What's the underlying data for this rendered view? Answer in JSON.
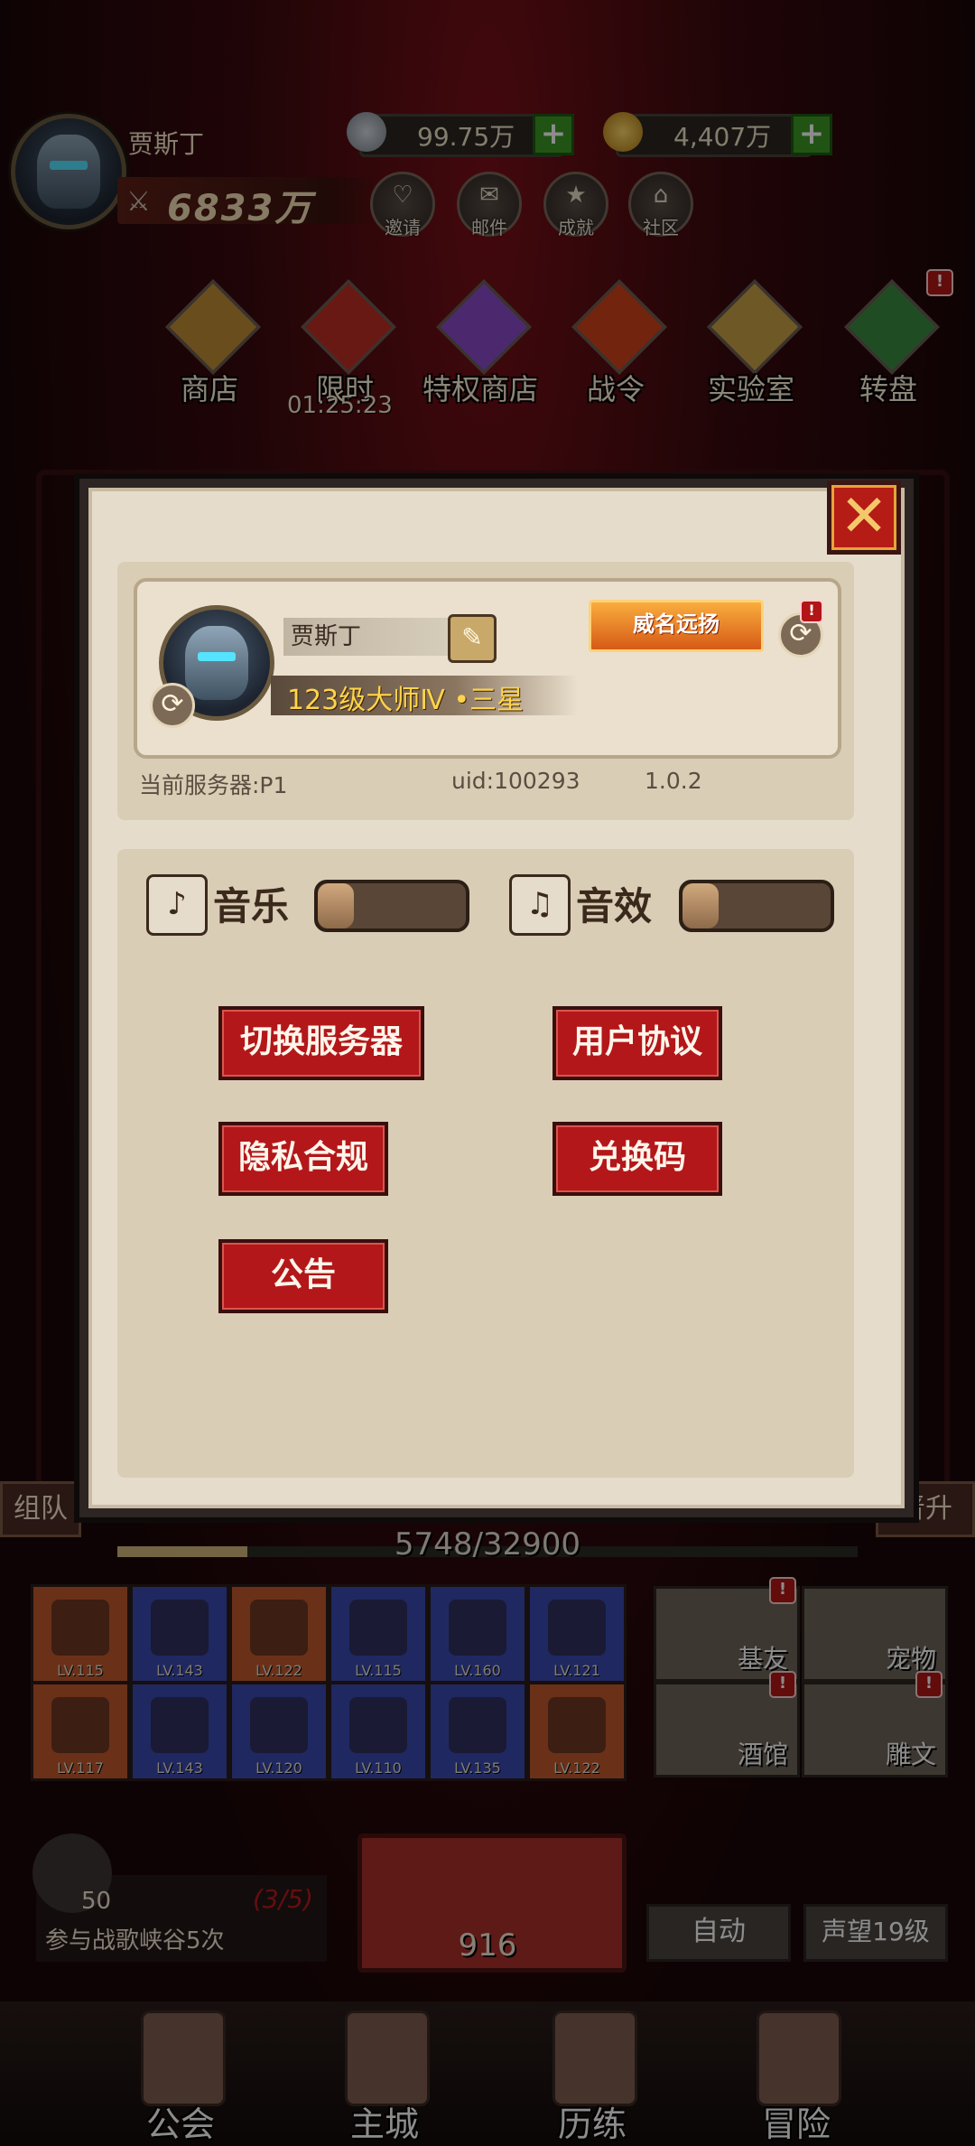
{
  "player": {
    "name": "贾斯丁",
    "power": "6833万"
  },
  "currency": {
    "silver": "99.75万",
    "gold": "4,407万"
  },
  "top_buttons": [
    {
      "label": "邀请",
      "icon": "heart-icon",
      "glyph": "♡"
    },
    {
      "label": "邮件",
      "icon": "mail-icon",
      "glyph": "✉"
    },
    {
      "label": "成就",
      "icon": "star-icon",
      "glyph": "★"
    },
    {
      "label": "社区",
      "icon": "house-icon",
      "glyph": "⌂"
    }
  ],
  "shops": [
    {
      "label": "商店",
      "color": "#c08c34"
    },
    {
      "label": "限时",
      "color": "#c02f26"
    },
    {
      "label": "特权商店",
      "color": "#8b4cc8"
    },
    {
      "label": "战令",
      "color": "#d0431b"
    },
    {
      "label": "实验室",
      "color": "#c8a044"
    },
    {
      "label": "转盘",
      "color": "#3b8a43"
    }
  ],
  "limited_timer": "01:25:23",
  "side_tabs": {
    "left": "组队",
    "right": "晋升"
  },
  "exp": {
    "text": "5748/32900",
    "fraction": 0.175
  },
  "equipment": [
    {
      "lv": "LV.115",
      "color": "#c25a2c"
    },
    {
      "lv": "LV.143",
      "color": "#3a4ab0"
    },
    {
      "lv": "LV.122",
      "color": "#c25a2c"
    },
    {
      "lv": "LV.115",
      "color": "#3a4ab0"
    },
    {
      "lv": "LV.160",
      "color": "#3a4ab0"
    },
    {
      "lv": "LV.121",
      "color": "#3a4ab0"
    },
    {
      "lv": "LV.117",
      "color": "#c25a2c"
    },
    {
      "lv": "LV.143",
      "color": "#3a4ab0"
    },
    {
      "lv": "LV.120",
      "color": "#3a4ab0"
    },
    {
      "lv": "LV.110",
      "color": "#3a4ab0"
    },
    {
      "lv": "LV.135",
      "color": "#3a4ab0"
    },
    {
      "lv": "LV.122",
      "color": "#c25a2c"
    }
  ],
  "social": [
    "基友",
    "宠物",
    "酒馆",
    "雕文"
  ],
  "quest": {
    "count": "50",
    "progress": "(3/5)",
    "text": "参与战歌峡谷5次"
  },
  "sack_value": "916",
  "auto_label": "自动",
  "reputation_label": "声望19级",
  "nav": [
    "公会",
    "主城",
    "历练",
    "冒险"
  ],
  "modal": {
    "close_glyph": "✕",
    "name": "贾斯丁",
    "edit_glyph": "✎",
    "rank": "123级大师Ⅳ •三星",
    "title_badge": "威名远扬",
    "server": "当前服务器:P1",
    "uid": "uid:100293",
    "version": "1.0.2",
    "music_label": "音乐",
    "sfx_label": "音效",
    "music_level": 0,
    "sfx_level": 0,
    "buttons": {
      "switch_server": "切换服务器",
      "user_agreement": "用户协议",
      "privacy": "隐私合规",
      "redeem": "兑换码",
      "notice": "公告"
    }
  },
  "badge_glyph": "!",
  "swap_glyph": "⟳",
  "music_glyph": "♪",
  "sfx_glyph": "♫"
}
